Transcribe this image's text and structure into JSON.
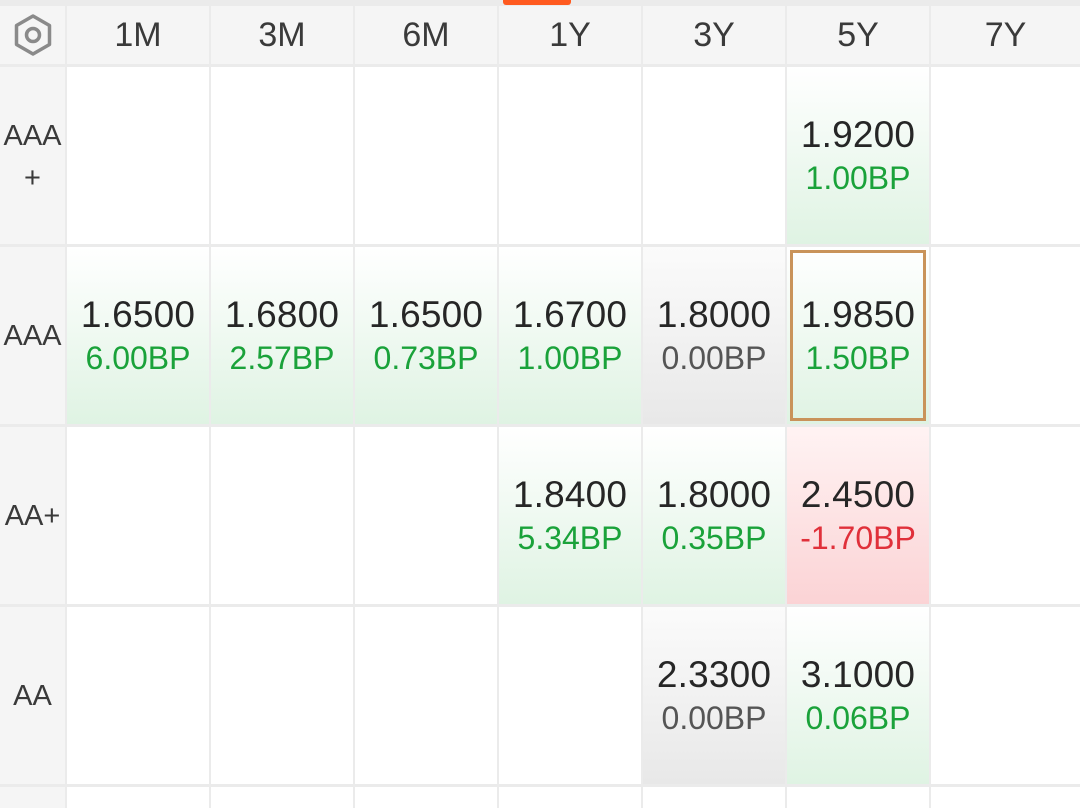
{
  "columns": [
    "1M",
    "3M",
    "6M",
    "1Y",
    "3Y",
    "5Y",
    "7Y"
  ],
  "rows": [
    {
      "label": "AAA+",
      "cells": [
        null,
        null,
        null,
        null,
        null,
        {
          "value": "1.9200",
          "change": "1.00BP",
          "trend": "up"
        },
        null
      ]
    },
    {
      "label": "AAA",
      "cells": [
        {
          "value": "1.6500",
          "change": "6.00BP",
          "trend": "up"
        },
        {
          "value": "1.6800",
          "change": "2.57BP",
          "trend": "up"
        },
        {
          "value": "1.6500",
          "change": "0.73BP",
          "trend": "up"
        },
        {
          "value": "1.6700",
          "change": "1.00BP",
          "trend": "up"
        },
        {
          "value": "1.8000",
          "change": "0.00BP",
          "trend": "flat"
        },
        {
          "value": "1.9850",
          "change": "1.50BP",
          "trend": "up",
          "selected": true
        },
        null
      ]
    },
    {
      "label": "AA+",
      "cells": [
        null,
        null,
        null,
        {
          "value": "1.8400",
          "change": "5.34BP",
          "trend": "up"
        },
        {
          "value": "1.8000",
          "change": "0.35BP",
          "trend": "up"
        },
        {
          "value": "2.4500",
          "change": "-1.70BP",
          "trend": "down"
        },
        null
      ]
    },
    {
      "label": "AA",
      "cells": [
        null,
        null,
        null,
        null,
        {
          "value": "2.3300",
          "change": "0.00BP",
          "trend": "flat"
        },
        {
          "value": "3.1000",
          "change": "0.06BP",
          "trend": "up"
        },
        null
      ]
    },
    {
      "label": "",
      "cells": [
        null,
        null,
        null,
        null,
        null,
        null,
        null
      ]
    }
  ],
  "icons": {
    "corner": "settings-hexagon-icon"
  },
  "colors": {
    "up": "#1aa23a",
    "down": "#e0303a",
    "flat": "#555555",
    "selected_border": "#c9935a",
    "accent": "#ff5a1f"
  }
}
